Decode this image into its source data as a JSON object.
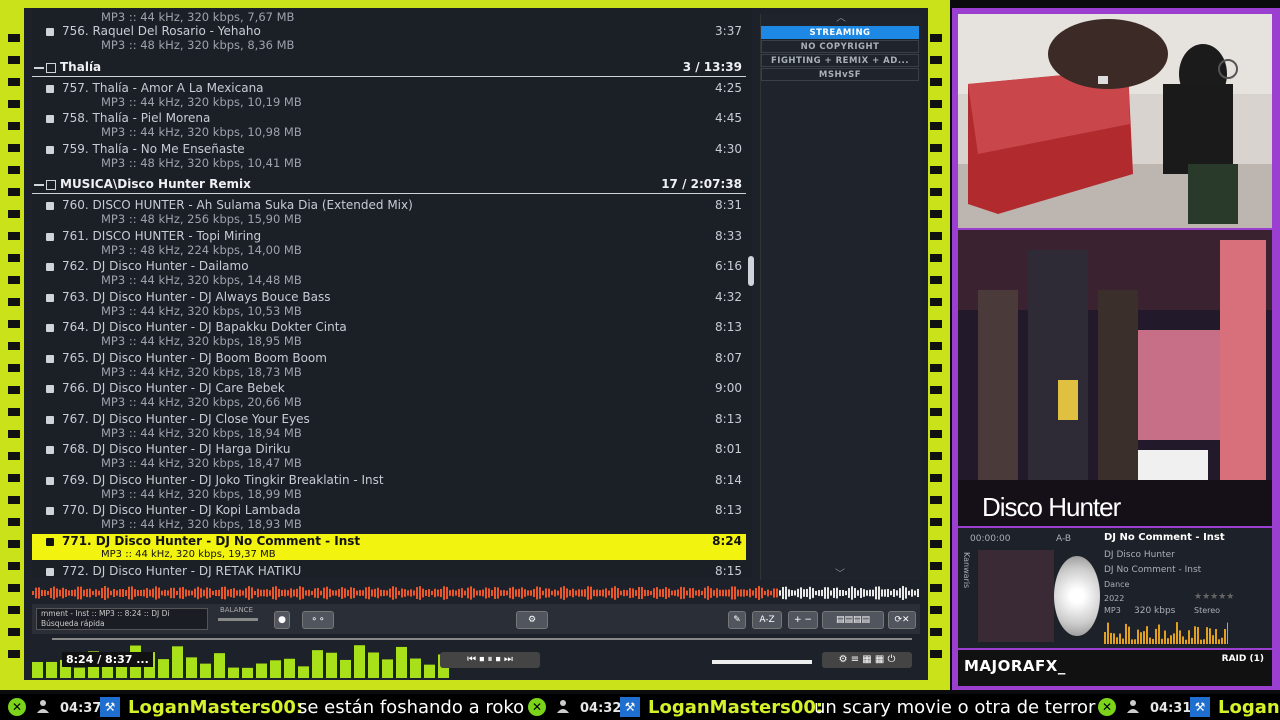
{
  "playlist": {
    "top_partial_meta": "MP3 :: 44 kHz, 320 kbps, 7,67 MB",
    "rows": [
      {
        "title": "756. Raquel Del Rosario - Yehaho",
        "meta": "MP3 :: 48 kHz, 320 kbps, 8,36 MB",
        "dur": "3:37"
      },
      {
        "group": "Thalía",
        "count": "3 / 13:39"
      },
      {
        "title": "757. Thalía - Amor A La Mexicana",
        "meta": "MP3 :: 44 kHz, 320 kbps, 10,19 MB",
        "dur": "4:25"
      },
      {
        "title": "758. Thalía - Piel Morena",
        "meta": "MP3 :: 44 kHz, 320 kbps, 10,98 MB",
        "dur": "4:45"
      },
      {
        "title": "759. Thalía - No Me Enseñaste",
        "meta": "MP3 :: 48 kHz, 320 kbps, 10,41 MB",
        "dur": "4:30"
      },
      {
        "group": "MUSICA\\Disco Hunter Remix",
        "count": "17 / 2:07:38"
      },
      {
        "title": "760. DISCO HUNTER - Ah Sulama Suka Dia (Extended Mix)",
        "meta": "MP3 :: 48 kHz, 256 kbps, 15,90 MB",
        "dur": "8:31"
      },
      {
        "title": "761. DISCO HUNTER - Topi Miring",
        "meta": "MP3 :: 48 kHz, 224 kbps, 14,00 MB",
        "dur": "8:33"
      },
      {
        "title": "762. DJ Disco Hunter - Dailamo",
        "meta": "MP3 :: 44 kHz, 320 kbps, 14,48 MB",
        "dur": "6:16"
      },
      {
        "title": "763. DJ Disco Hunter - DJ Always Bouce Bass",
        "meta": "MP3 :: 44 kHz, 320 kbps, 10,53 MB",
        "dur": "4:32"
      },
      {
        "title": "764. DJ Disco Hunter - DJ Bapakku Dokter Cinta",
        "meta": "MP3 :: 44 kHz, 320 kbps, 18,95 MB",
        "dur": "8:13"
      },
      {
        "title": "765. DJ Disco Hunter - DJ Boom Boom Boom",
        "meta": "MP3 :: 44 kHz, 320 kbps, 18,73 MB",
        "dur": "8:07"
      },
      {
        "title": "766. DJ Disco Hunter - DJ Care Bebek",
        "meta": "MP3 :: 44 kHz, 320 kbps, 20,66 MB",
        "dur": "9:00"
      },
      {
        "title": "767. DJ Disco Hunter - DJ Close Your Eyes",
        "meta": "MP3 :: 44 kHz, 320 kbps, 18,94 MB",
        "dur": "8:13"
      },
      {
        "title": "768. DJ Disco Hunter - DJ Harga Diriku",
        "meta": "MP3 :: 44 kHz, 320 kbps, 18,47 MB",
        "dur": "8:01"
      },
      {
        "title": "769. DJ Disco Hunter - DJ Joko Tingkir Breaklatin - Inst",
        "meta": "MP3 :: 44 kHz, 320 kbps, 18,99 MB",
        "dur": "8:14"
      },
      {
        "title": "770. DJ Disco Hunter - DJ Kopi Lambada",
        "meta": "MP3 :: 44 kHz, 320 kbps, 18,93 MB",
        "dur": "8:13"
      },
      {
        "title": "771. DJ Disco Hunter - DJ No Comment - Inst",
        "meta": "MP3 :: 44 kHz, 320 kbps, 19,37 MB",
        "dur": "8:24",
        "active": true
      },
      {
        "title": "772. DJ Disco Hunter - DJ RETAK HATIKU",
        "meta": "MP3 :: 44 kHz, 320 kbps, 18,96 MB",
        "dur": "8:15"
      }
    ]
  },
  "side_menu": [
    "STREAMING",
    "NO COPYRIGHT",
    "FIGHTING + REMIX + AD...",
    "MSHvSF"
  ],
  "controls": {
    "mini_status_line1": "mment - Inst :: MP3 :: 8:24 :: DJ Di",
    "mini_status_line2": "Búsqueda rápida",
    "balance_label": "BALANCE",
    "sort_label": "A-Z"
  },
  "bottom": {
    "time": "8:24 / 8:37 ..."
  },
  "now_playing": {
    "cover_text": "Disco Hunter",
    "time": "00:00:00",
    "ab": "A-B",
    "title": "DJ No Comment - Inst",
    "artist": "DJ Disco Hunter",
    "album": "DJ No Comment - Inst",
    "genre": "Dance",
    "year": "2022",
    "format": "MP3",
    "bitrate": "320 kbps",
    "channels": "Stereo",
    "rating_stars": "★★★★★",
    "vertical_label": "Kanwaris"
  },
  "streamer": {
    "name": "MAJORAFX_",
    "raid": "RAID (1)"
  },
  "ticker": [
    {
      "time": "04:37",
      "user": "LoganMasters00:",
      "msg": "se están foshando a roko"
    },
    {
      "time": "04:32",
      "user": "LoganMasters00:",
      "msg": "un scary movie o otra de terror"
    },
    {
      "time": "04:31",
      "user": "LoganMa"
    }
  ],
  "colors": {
    "frame": "#c9e21a",
    "active_row": "#f2f30f",
    "accent_purple": "#9b3fd1",
    "streaming_blue": "#1e88e5"
  }
}
